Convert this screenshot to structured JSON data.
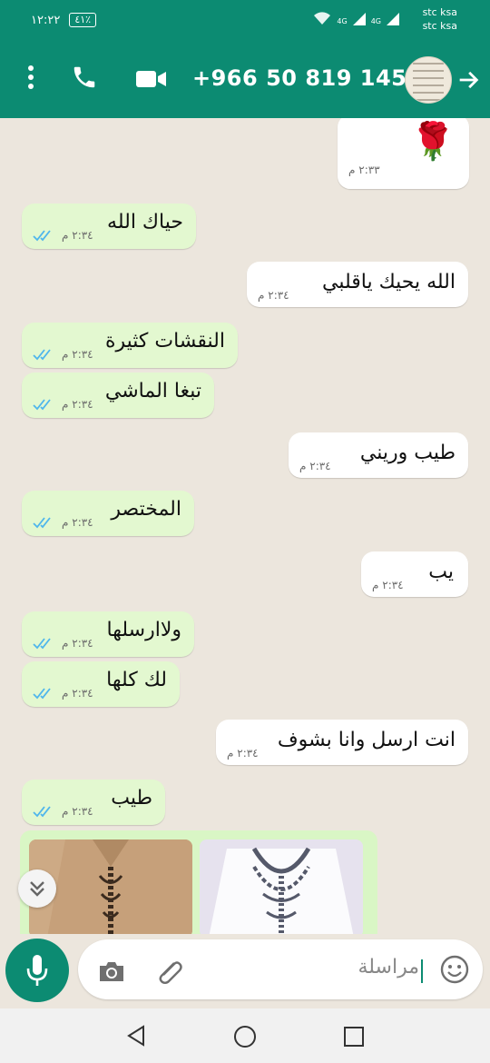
{
  "status_bar": {
    "time": "١٢:٢٢",
    "battery": "٤١٪",
    "carrier_1": "stc ksa",
    "carrier_2": "stc ksa",
    "network_1": "4G",
    "network_2": "4G"
  },
  "header": {
    "contact_number": "+966 50 819 1455"
  },
  "messages": [
    {
      "direction": "incoming",
      "type": "image",
      "emoji": "🌹",
      "time": "٢:٣٣ م"
    },
    {
      "direction": "outgoing",
      "text": "حياك الله",
      "time": "٢:٣٤ م",
      "status": "read"
    },
    {
      "direction": "incoming",
      "text": "الله يحيك ياقلبي",
      "time": "٢:٣٤ م"
    },
    {
      "direction": "outgoing",
      "text": "النقشات كثيرة",
      "time": "٢:٣٤ م",
      "status": "read"
    },
    {
      "direction": "outgoing",
      "text": "تبغا الماشي",
      "time": "٢:٣٤ م",
      "status": "read"
    },
    {
      "direction": "incoming",
      "text": "طيب وريني",
      "time": "٢:٣٤ م"
    },
    {
      "direction": "outgoing",
      "text": "المختصر",
      "time": "٢:٣٤ م",
      "status": "read"
    },
    {
      "direction": "incoming",
      "text": "يب",
      "time": "٢:٣٤ م"
    },
    {
      "direction": "outgoing",
      "text": "ولاارسلها",
      "time": "٢:٣٤ م",
      "status": "read"
    },
    {
      "direction": "outgoing",
      "text": "لك كلها",
      "time": "٢:٣٤ م",
      "status": "read"
    },
    {
      "direction": "incoming",
      "text": "انت ارسل وانا بشوف",
      "time": "٢:٣٤ م"
    },
    {
      "direction": "outgoing",
      "text": "طيب",
      "time": "٢:٣٤ م",
      "status": "read"
    }
  ],
  "composer": {
    "placeholder": "مراسلة"
  },
  "colors": {
    "brand": "#0c8b72",
    "outgoing_bubble": "#e3f8d0",
    "incoming_bubble": "#ffffff",
    "read_ticks": "#4fb6ec"
  },
  "icons": {
    "menu": "more-vert-icon",
    "call": "phone-icon",
    "video": "video-icon",
    "back": "arrow-back-icon",
    "emoji": "emoji-icon",
    "attach": "paperclip-icon",
    "camera": "camera-icon",
    "mic": "mic-icon",
    "scroll": "chevrons-down-icon"
  }
}
